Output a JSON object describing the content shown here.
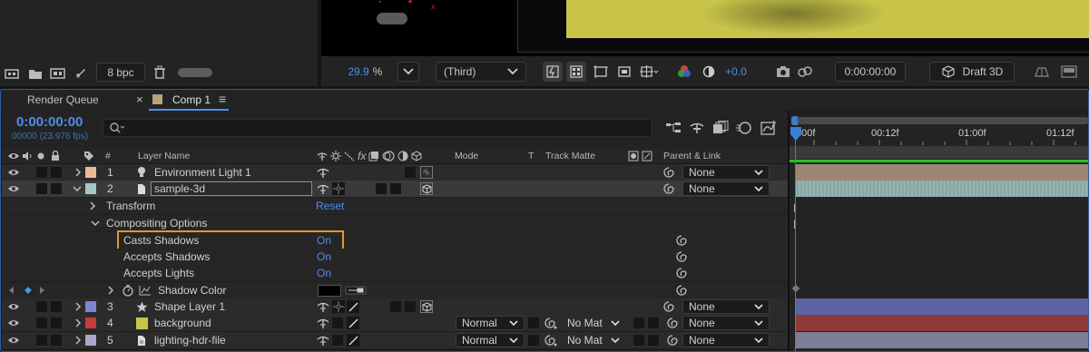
{
  "viewer": {
    "bit_depth": "8 bpc",
    "zoom": "29.9",
    "zoom_unit": "%",
    "view": "(Third)",
    "offset": "+0.0",
    "timecode": "0:00:00:00",
    "renderer": "Draft 3D",
    "axis_marker": "x"
  },
  "tabs": {
    "render_queue": "Render Queue",
    "comp": "Comp 1",
    "close": "×",
    "menu": "≡"
  },
  "comp": {
    "timecode": "0:00:00:00",
    "frames": "00000 (23.976 fps)",
    "search_placeholder": ""
  },
  "columns": {
    "num": "#",
    "layer_name": "Layer Name",
    "mode": "Mode",
    "t": "T",
    "track_matte": "Track Matte",
    "parent_link": "Parent & Link"
  },
  "ruler": {
    "ticks": [
      "0:00f",
      "00:12f",
      "01:00f",
      "01:12f"
    ]
  },
  "layers": [
    {
      "num": "1",
      "name": "Environment Light 1",
      "color": "#e8b897",
      "parent": "None",
      "bar_color": "#9e8472"
    },
    {
      "num": "2",
      "name": "sample-3d",
      "color": "#a8c6c4",
      "parent": "None",
      "bar_color": "#8eb0ae"
    },
    {
      "num": "3",
      "name": "Shape Layer 1",
      "color": "#7c86d6",
      "parent": "None",
      "bar_color": "#5b65a3"
    },
    {
      "num": "4",
      "name": "background",
      "color": "#c93a3a",
      "mode": "Normal",
      "matte": "No Mat",
      "parent": "None",
      "bar_color": "#8e3a3a"
    },
    {
      "num": "5",
      "name": "lighting-hdr-file",
      "color": "#a8a8c8",
      "mode": "Normal",
      "matte": "No Mat",
      "parent": "None",
      "bar_color": "#7e7e96"
    }
  ],
  "properties": {
    "transform": "Transform",
    "transform_reset": "Reset",
    "compositing": "Compositing Options",
    "casts_shadows": "Casts Shadows",
    "casts_shadows_val": "On",
    "accepts_shadows": "Accepts Shadows",
    "accepts_shadows_val": "On",
    "accepts_lights": "Accepts Lights",
    "accepts_lights_val": "On",
    "shadow_color": "Shadow Color"
  },
  "colors": {
    "accent_blue": "#4f8fe8",
    "highlight_orange": "#e8952a"
  }
}
